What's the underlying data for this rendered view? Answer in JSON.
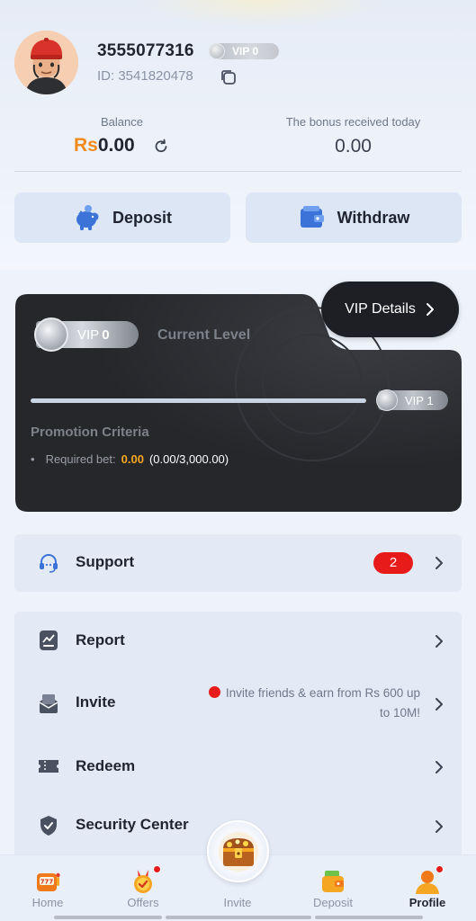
{
  "profile": {
    "username": "3555077316",
    "vip_badge": "VIP 0",
    "user_id": "ID: 3541820478"
  },
  "balance": {
    "label": "Balance",
    "currency": "Rs",
    "amount": "0.00",
    "bonus_label": "The bonus received today",
    "bonus_amount": "0.00"
  },
  "actions": {
    "deposit_label": "Deposit",
    "withdraw_label": "Withdraw"
  },
  "vip_card": {
    "details_label": "VIP Details",
    "current_vip_prefix": "VIP",
    "current_vip_level": "0",
    "current_level_label": "Current Level",
    "next_vip": "VIP 1",
    "progress_fraction": 0,
    "promotion_title": "Promotion Criteria",
    "required_bet_label": "Required bet:",
    "required_bet_amount": "0.00",
    "required_bet_ratio": "(0.00/3,000.00)"
  },
  "menu": {
    "support": {
      "label": "Support",
      "badge": "2",
      "icon": "headset-icon"
    },
    "items": [
      {
        "label": "Report",
        "icon": "report-icon"
      },
      {
        "label": "Invite",
        "icon": "invite-icon",
        "note_line1": "Invite friends & earn from Rs 600 up",
        "note_line2": "to 10M!"
      },
      {
        "label": "Redeem",
        "icon": "ticket-icon"
      },
      {
        "label": "Security Center",
        "icon": "shield-icon"
      }
    ]
  },
  "bottom_nav": {
    "items": [
      {
        "label": "Home",
        "icon": "slot-machine-icon"
      },
      {
        "label": "Offers",
        "icon": "medal-icon"
      },
      {
        "label": "Invite",
        "icon": "treasure-chest-icon"
      },
      {
        "label": "Deposit",
        "icon": "wallet-icon"
      },
      {
        "label": "Profile",
        "icon": "user-icon"
      }
    ],
    "active": "Profile"
  },
  "colors": {
    "accent_orange": "#f08a1c",
    "bet_amount": "#f5a623",
    "badge_red": "#e81b1b",
    "card_dark": "#2c2d31",
    "page_bg": "#eef3fb"
  }
}
